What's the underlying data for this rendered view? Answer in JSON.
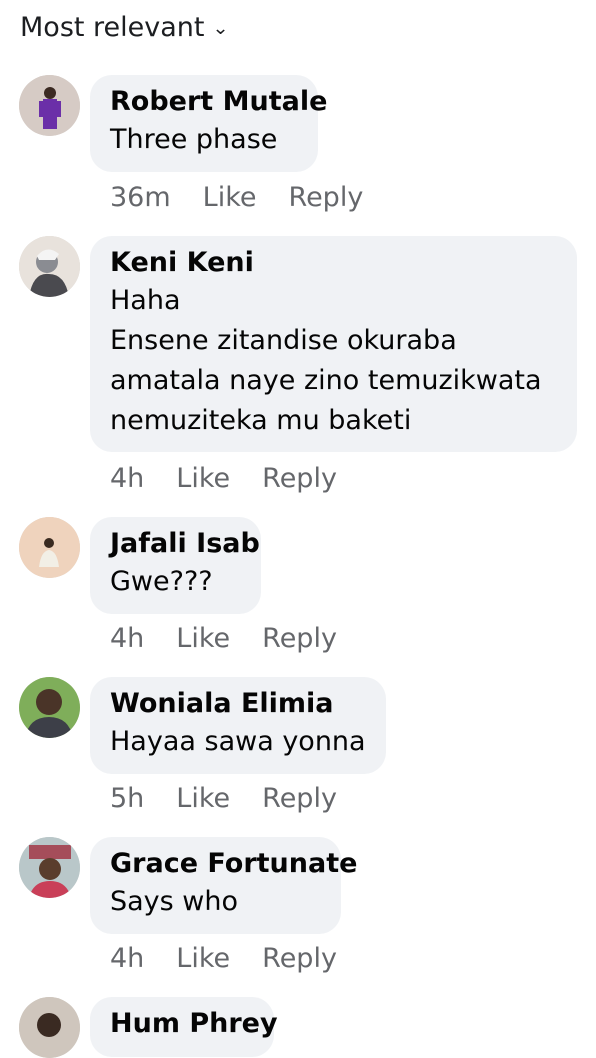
{
  "sort": {
    "label": "Most relevant"
  },
  "comments": [
    {
      "name": "Robert Mutale",
      "lines": [
        "Three phase"
      ],
      "time": "36m",
      "like": "Like",
      "reply": "Reply"
    },
    {
      "name": "Keni Keni",
      "lines": [
        "Haha",
        "Ensene zitandise okuraba",
        "amatala naye zino temuzikwata",
        "nemuziteka mu baketi"
      ],
      "time": "4h",
      "like": "Like",
      "reply": "Reply"
    },
    {
      "name": "Jafali Isab",
      "lines": [
        "Gwe???"
      ],
      "time": "4h",
      "like": "Like",
      "reply": "Reply"
    },
    {
      "name": "Woniala Elimia",
      "lines": [
        "Hayaa sawa yonna"
      ],
      "time": "5h",
      "like": "Like",
      "reply": "Reply"
    },
    {
      "name": "Grace Fortunate",
      "lines": [
        "Says who"
      ],
      "time": "4h",
      "like": "Like",
      "reply": "Reply"
    },
    {
      "name": "Hum Phrey",
      "lines": [],
      "time": "",
      "like": "",
      "reply": ""
    }
  ],
  "colors": {
    "bubble": "#f0f2f5",
    "meta": "#65676b",
    "text": "#050505"
  }
}
